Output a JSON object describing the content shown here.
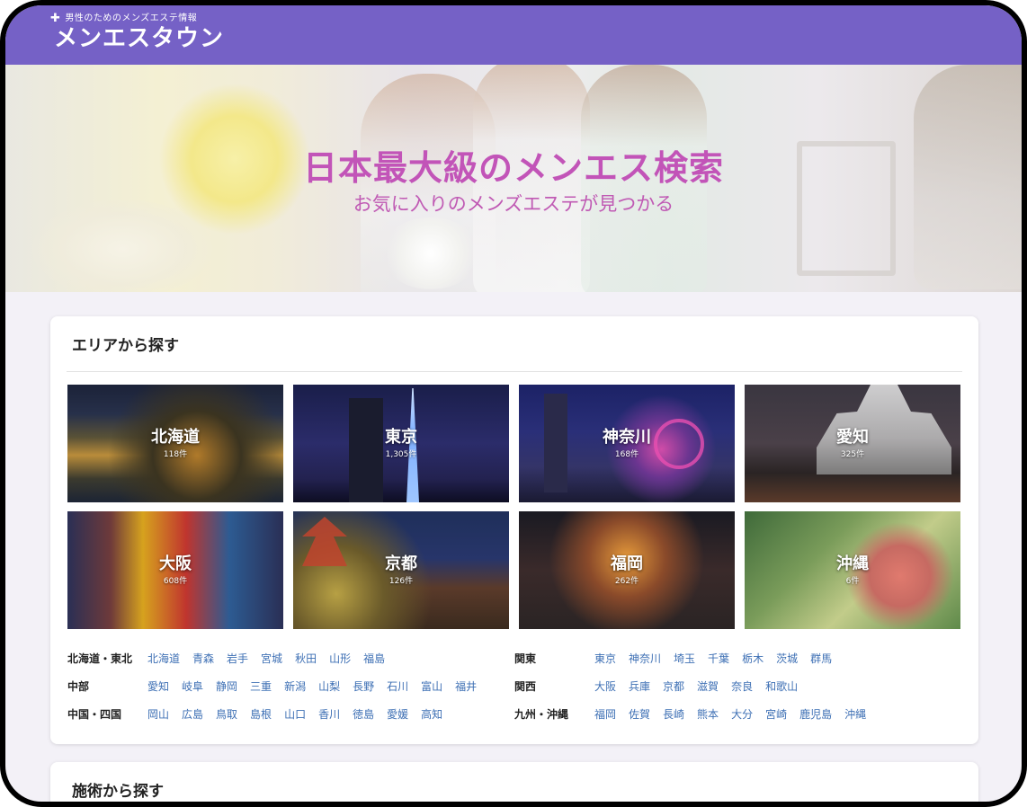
{
  "header": {
    "tagline": "男性のためのメンズエステ情報",
    "logo_text": "メンエスタウン",
    "plus_symbol": "✚"
  },
  "hero": {
    "title": "日本最大級のメンエス検索",
    "subtitle": "お気に入りのメンズエステが見つかる"
  },
  "area_section": {
    "title": "エリアから探す",
    "tiles": [
      {
        "name": "北海道",
        "count": "118件"
      },
      {
        "name": "東京",
        "count": "1,305件"
      },
      {
        "name": "神奈川",
        "count": "168件"
      },
      {
        "name": "愛知",
        "count": "325件"
      },
      {
        "name": "大阪",
        "count": "608件"
      },
      {
        "name": "京都",
        "count": "126件"
      },
      {
        "name": "福岡",
        "count": "262件"
      },
      {
        "name": "沖縄",
        "count": "6件"
      }
    ],
    "regions": [
      {
        "label": "北海道・東北",
        "links": [
          "北海道",
          "青森",
          "岩手",
          "宮城",
          "秋田",
          "山形",
          "福島"
        ]
      },
      {
        "label": "中部",
        "links": [
          "愛知",
          "岐阜",
          "静岡",
          "三重",
          "新潟",
          "山梨",
          "長野",
          "石川",
          "富山",
          "福井"
        ]
      },
      {
        "label": "中国・四国",
        "links": [
          "岡山",
          "広島",
          "鳥取",
          "島根",
          "山口",
          "香川",
          "徳島",
          "愛媛",
          "高知"
        ]
      },
      {
        "label": "関東",
        "links": [
          "東京",
          "神奈川",
          "埼玉",
          "千葉",
          "栃木",
          "茨城",
          "群馬"
        ]
      },
      {
        "label": "関西",
        "links": [
          "大阪",
          "兵庫",
          "京都",
          "滋賀",
          "奈良",
          "和歌山"
        ]
      },
      {
        "label": "九州・沖縄",
        "links": [
          "福岡",
          "佐賀",
          "長崎",
          "熊本",
          "大分",
          "宮崎",
          "鹿児島",
          "沖縄"
        ]
      }
    ]
  },
  "technique_section": {
    "title": "施術から探す"
  },
  "colors": {
    "header_bg": "#7561c6",
    "hero_title": "#c254b8",
    "link": "#3d6fb4"
  }
}
